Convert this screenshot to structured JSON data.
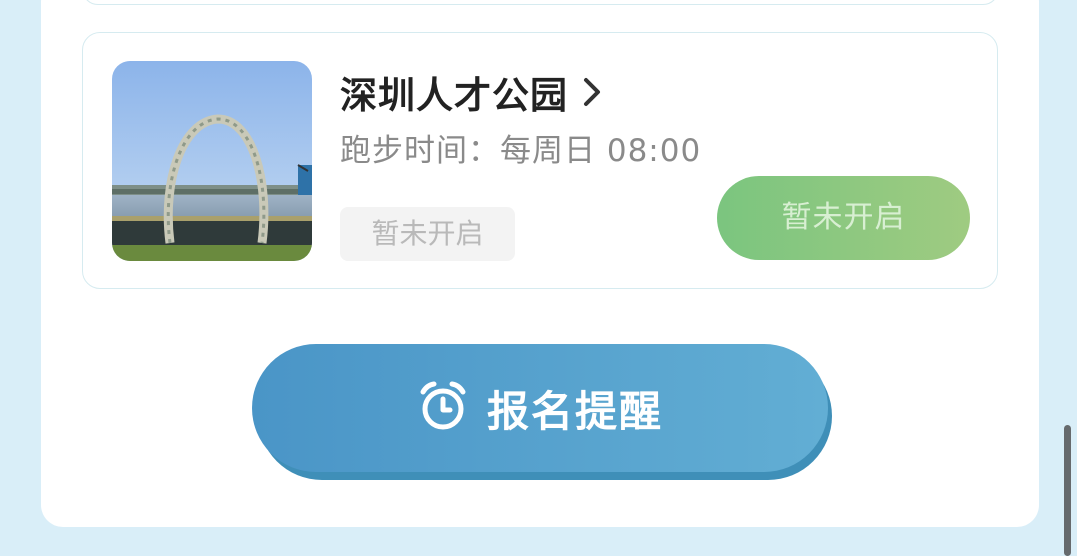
{
  "park": {
    "name": "深圳人才公园",
    "run_time": "跑步时间：每周日 08:00",
    "status_tag": "暂未开启",
    "status_button": "暂未开启",
    "photo_icon": "park-photo"
  },
  "reminder_button": {
    "label": "报名提醒",
    "icon": "alarm-clock-icon"
  },
  "colors": {
    "page_background": "#d9eef8",
    "panel": "#ffffff",
    "status_green": "#7bc57f",
    "remind_blue": "#4a95c7",
    "title_text": "#222222",
    "secondary_text": "#8a8a8a"
  }
}
